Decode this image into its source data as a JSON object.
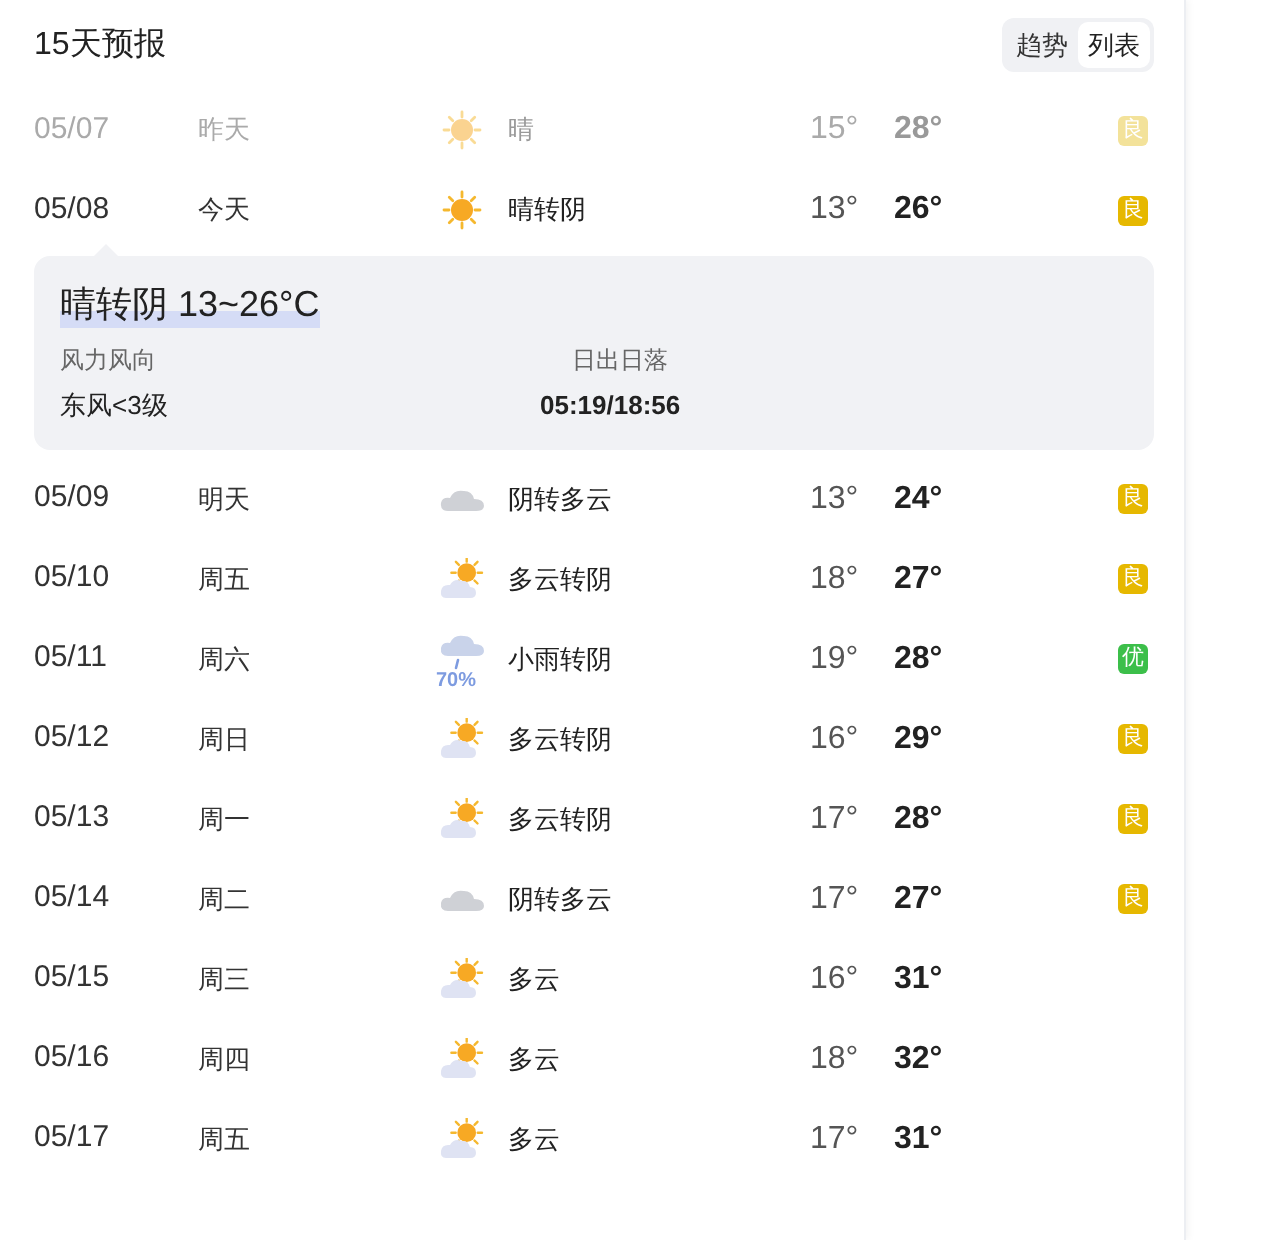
{
  "title": "15天预报",
  "view_toggle": [
    {
      "label": "趋势",
      "selected": false
    },
    {
      "label": "列表",
      "selected": true
    }
  ],
  "days": [
    {
      "date": "05/07",
      "day": "昨天",
      "kind": "sun",
      "weather": "晴",
      "low": "15°",
      "high": "28°",
      "aqi": "良",
      "color": "#f3e29a",
      "past": true
    },
    {
      "date": "05/08",
      "day": "今天",
      "kind": "sun",
      "weather": "晴转阴",
      "low": "13°",
      "high": "26°",
      "aqi": "良",
      "color": "#e6b800",
      "past": false,
      "detail": {
        "summary": "晴转阴 13~26°C",
        "wind_label": "风力风向",
        "wind": "东风<3级",
        "sun_label": "日出日落",
        "sun": "05:19/18:56"
      }
    },
    {
      "date": "05/09",
      "day": "明天",
      "kind": "overcast",
      "weather": "阴转多云",
      "low": "13°",
      "high": "24°",
      "aqi": "良",
      "color": "#e6b800",
      "past": false
    },
    {
      "date": "05/10",
      "day": "周五",
      "kind": "partly_cloudy",
      "weather": "多云转阴",
      "low": "18°",
      "high": "27°",
      "aqi": "良",
      "color": "#e6b800",
      "past": false
    },
    {
      "date": "05/11",
      "day": "周六",
      "kind": "rain",
      "precip": "70%",
      "weather": "小雨转阴",
      "low": "19°",
      "high": "28°",
      "aqi": "优",
      "color": "#3cbf4a",
      "past": false
    },
    {
      "date": "05/12",
      "day": "周日",
      "kind": "partly_cloudy",
      "weather": "多云转阴",
      "low": "16°",
      "high": "29°",
      "aqi": "良",
      "color": "#e6b800",
      "past": false
    },
    {
      "date": "05/13",
      "day": "周一",
      "kind": "partly_cloudy",
      "weather": "多云转阴",
      "low": "17°",
      "high": "28°",
      "aqi": "良",
      "color": "#e6b800",
      "past": false
    },
    {
      "date": "05/14",
      "day": "周二",
      "kind": "overcast",
      "weather": "阴转多云",
      "low": "17°",
      "high": "27°",
      "aqi": "良",
      "color": "#e6b800",
      "past": false
    },
    {
      "date": "05/15",
      "day": "周三",
      "kind": "partly_cloudy",
      "weather": "多云",
      "low": "16°",
      "high": "31°",
      "past": false
    },
    {
      "date": "05/16",
      "day": "周四",
      "kind": "partly_cloudy",
      "weather": "多云",
      "low": "18°",
      "high": "32°",
      "past": false
    },
    {
      "date": "05/17",
      "day": "周五",
      "kind": "partly_cloudy",
      "weather": "多云",
      "low": "17°",
      "high": "31°",
      "past": false
    }
  ]
}
